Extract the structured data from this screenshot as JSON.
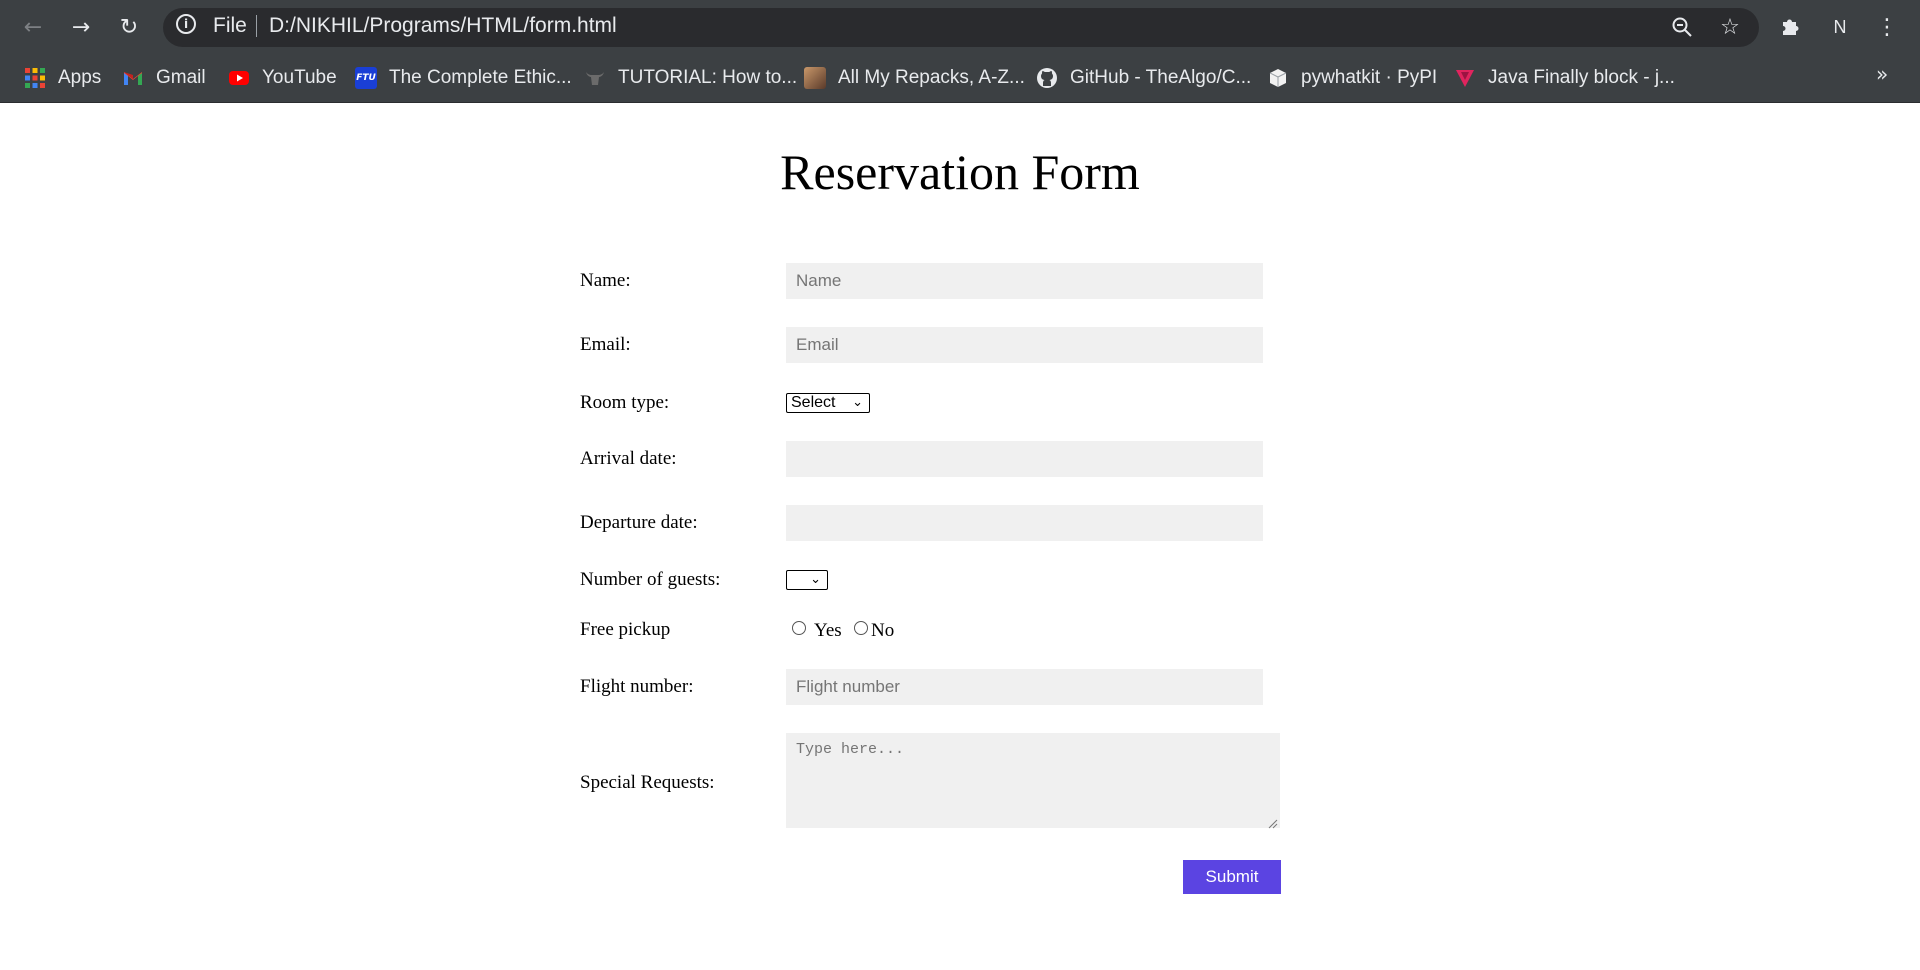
{
  "browser": {
    "url_scheme": "File",
    "url": "D:/NIKHIL/Programs/HTML/form.html",
    "profile_initial": "N",
    "bookmarks": [
      {
        "label": "Apps",
        "icon": "apps-grid-icon",
        "color": "#ea4335"
      },
      {
        "label": "Gmail",
        "icon": "gmail-icon",
        "color": "#ea4335"
      },
      {
        "label": "YouTube",
        "icon": "youtube-icon",
        "color": "#ff0000"
      },
      {
        "label": "The Complete Ethic...",
        "icon": "ftu-icon",
        "color": "#1a3fd6"
      },
      {
        "label": "TUTORIAL: How to...",
        "icon": "bull-icon",
        "color": "#6b6b6b"
      },
      {
        "label": "All My Repacks, A-Z...",
        "icon": "avatar-photo-icon",
        "color": "#8a5a3c"
      },
      {
        "label": "GitHub - TheAlgo/C...",
        "icon": "github-icon",
        "color": "#e8eaed"
      },
      {
        "label": "pywhatkit · PyPI",
        "icon": "pypi-cube-icon",
        "color": "#f2f2f2"
      },
      {
        "label": "Java Finally block - j...",
        "icon": "javatpoint-icon",
        "color": "#e0245e"
      }
    ],
    "more_bookmarks": "»"
  },
  "form": {
    "title": "Reservation Form",
    "name_label": "Name:",
    "name_placeholder": "Name",
    "email_label": "Email:",
    "email_placeholder": "Email",
    "room_type_label": "Room type:",
    "room_type_value": "Select",
    "arrival_label": "Arrival date:",
    "departure_label": "Departure date:",
    "guests_label": "Number of guests:",
    "guests_value": "",
    "pickup_label": "Free pickup",
    "pickup_yes": "Yes",
    "pickup_no": "No",
    "flight_label": "Flight number:",
    "flight_placeholder": "Flight number",
    "requests_label": "Special Requests:",
    "requests_placeholder": "Type here...",
    "submit_label": "Submit",
    "accent_color": "#5b44e2"
  }
}
